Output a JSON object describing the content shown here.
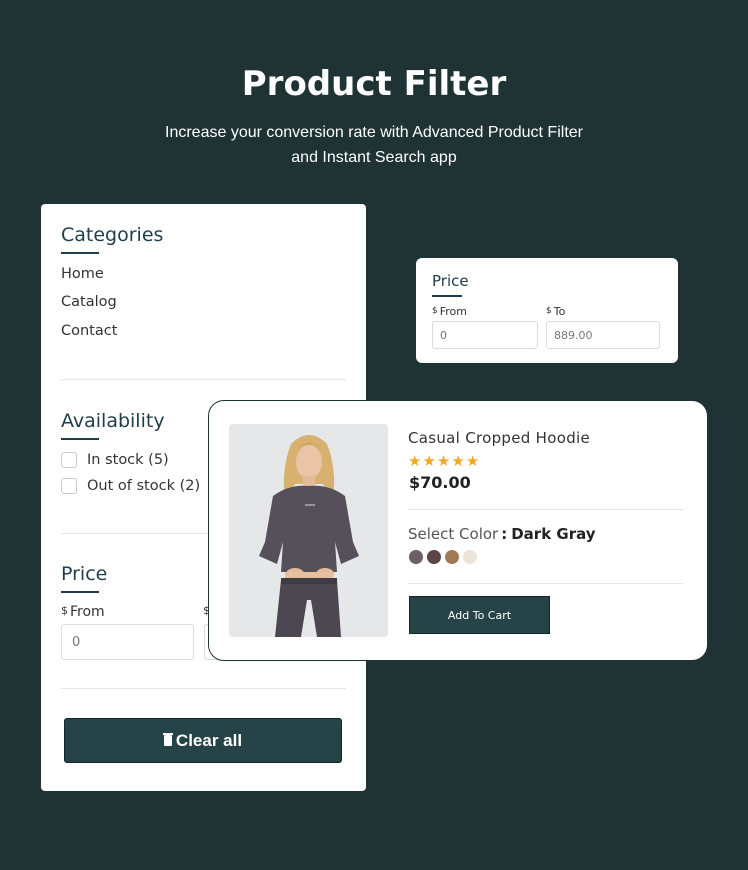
{
  "hero": {
    "title": "Product Filter",
    "subtitle": "Increase your conversion rate with Advanced Product Filter and Instant Search app"
  },
  "filter_panel": {
    "categories": {
      "title": "Categories",
      "links": [
        "Home",
        "Catalog",
        "Contact"
      ]
    },
    "availability": {
      "title": "Availability",
      "options": [
        {
          "label": "In stock (5)",
          "checked": false
        },
        {
          "label": "Out of stock (2)",
          "checked": false
        }
      ]
    },
    "price": {
      "title": "Price",
      "currency": "$",
      "from_label": "From",
      "from_value": "0",
      "to_currency": "$"
    },
    "clear_all_label": "Clear all",
    "clear_icon": "trash-icon"
  },
  "price_card": {
    "title": "Price",
    "currency": "$",
    "from_label": "From",
    "to_label": "To",
    "from_value": "0",
    "to_value": "889.00"
  },
  "product": {
    "name": "Casual Cropped Hoodie",
    "rating": 5,
    "price": "$70.00",
    "color_label": "Select Color",
    "color_separator": ":",
    "selected_color": "Dark Gray",
    "swatches": [
      "#6d5f67",
      "#5b4546",
      "#a07b56",
      "#ede3da"
    ],
    "add_to_cart_label": "Add To Cart"
  },
  "colors": {
    "background": "#1f3234",
    "accent": "#264448",
    "star": "#f5a623"
  }
}
